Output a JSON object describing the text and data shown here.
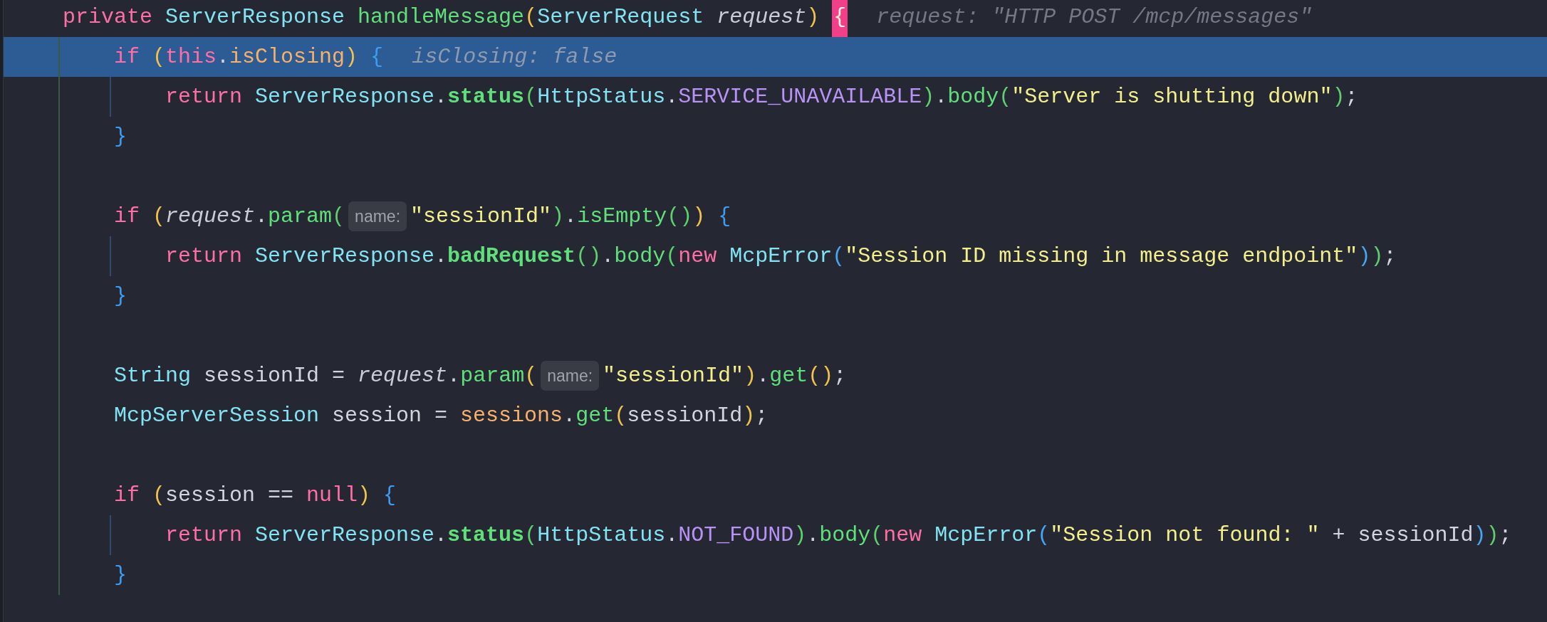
{
  "editor": {
    "lines": [
      {
        "kind": "code",
        "selected": false,
        "tokens": [
          {
            "kind": "keyword",
            "text": "private "
          },
          {
            "kind": "type",
            "text": "ServerResponse "
          },
          {
            "kind": "method",
            "text": "handleMessage"
          },
          {
            "kind": "paren1",
            "text": "("
          },
          {
            "kind": "type",
            "text": "ServerRequest "
          },
          {
            "kind": "param",
            "text": "request"
          },
          {
            "kind": "paren1",
            "text": ") "
          },
          {
            "kind": "brace_match",
            "text": "{"
          },
          {
            "kind": "hint",
            "text": "request: \"HTTP POST /mcp/messages\""
          }
        ],
        "children": [
          {
            "kind": "code",
            "selected": true,
            "tokens": [
              {
                "kind": "keyword",
                "text": "if "
              },
              {
                "kind": "paren1",
                "text": "("
              },
              {
                "kind": "keyword",
                "text": "this"
              },
              {
                "kind": "plain",
                "text": "."
              },
              {
                "kind": "field",
                "text": "isClosing"
              },
              {
                "kind": "paren1",
                "text": ") "
              },
              {
                "kind": "brace",
                "text": "{"
              },
              {
                "kind": "hint",
                "text": "isClosing: false"
              }
            ],
            "children": [
              {
                "kind": "code",
                "selected": false,
                "tokens": [
                  {
                    "kind": "keyword",
                    "text": "return "
                  },
                  {
                    "kind": "type",
                    "text": "ServerResponse"
                  },
                  {
                    "kind": "plain",
                    "text": "."
                  },
                  {
                    "kind": "method_bold",
                    "text": "status"
                  },
                  {
                    "kind": "paren2",
                    "text": "("
                  },
                  {
                    "kind": "type",
                    "text": "HttpStatus"
                  },
                  {
                    "kind": "plain",
                    "text": "."
                  },
                  {
                    "kind": "constant",
                    "text": "SERVICE_UNAVAILABLE"
                  },
                  {
                    "kind": "paren2",
                    "text": ")"
                  },
                  {
                    "kind": "plain",
                    "text": "."
                  },
                  {
                    "kind": "method",
                    "text": "body"
                  },
                  {
                    "kind": "paren2",
                    "text": "("
                  },
                  {
                    "kind": "string",
                    "text": "\"Server is shutting down\""
                  },
                  {
                    "kind": "paren2",
                    "text": ")"
                  },
                  {
                    "kind": "plain",
                    "text": ";"
                  }
                ]
              }
            ]
          },
          {
            "kind": "code",
            "selected": false,
            "tokens": [
              {
                "kind": "brace",
                "text": "}"
              }
            ]
          },
          {
            "kind": "blank",
            "selected": false
          },
          {
            "kind": "code",
            "selected": false,
            "tokens": [
              {
                "kind": "keyword",
                "text": "if "
              },
              {
                "kind": "paren1",
                "text": "("
              },
              {
                "kind": "param",
                "text": "request"
              },
              {
                "kind": "plain",
                "text": "."
              },
              {
                "kind": "method",
                "text": "param"
              },
              {
                "kind": "paren2",
                "text": "("
              },
              {
                "kind": "param_hint",
                "text": "name:"
              },
              {
                "kind": "string",
                "text": "\"sessionId\""
              },
              {
                "kind": "paren2",
                "text": ")"
              },
              {
                "kind": "plain",
                "text": "."
              },
              {
                "kind": "method",
                "text": "isEmpty"
              },
              {
                "kind": "paren2",
                "text": "()"
              },
              {
                "kind": "paren1",
                "text": ") "
              },
              {
                "kind": "brace",
                "text": "{"
              }
            ],
            "children": [
              {
                "kind": "code",
                "selected": false,
                "tokens": [
                  {
                    "kind": "keyword",
                    "text": "return "
                  },
                  {
                    "kind": "type",
                    "text": "ServerResponse"
                  },
                  {
                    "kind": "plain",
                    "text": "."
                  },
                  {
                    "kind": "method_bold",
                    "text": "badRequest"
                  },
                  {
                    "kind": "paren2",
                    "text": "()"
                  },
                  {
                    "kind": "plain",
                    "text": "."
                  },
                  {
                    "kind": "method",
                    "text": "body"
                  },
                  {
                    "kind": "paren2",
                    "text": "("
                  },
                  {
                    "kind": "keyword",
                    "text": "new "
                  },
                  {
                    "kind": "type",
                    "text": "McpError"
                  },
                  {
                    "kind": "paren3",
                    "text": "("
                  },
                  {
                    "kind": "string",
                    "text": "\"Session ID missing in message endpoint\""
                  },
                  {
                    "kind": "paren3",
                    "text": ")"
                  },
                  {
                    "kind": "paren2",
                    "text": ")"
                  },
                  {
                    "kind": "plain",
                    "text": ";"
                  }
                ]
              }
            ]
          },
          {
            "kind": "code",
            "selected": false,
            "tokens": [
              {
                "kind": "brace",
                "text": "}"
              }
            ]
          },
          {
            "kind": "blank",
            "selected": false
          },
          {
            "kind": "code",
            "selected": false,
            "tokens": [
              {
                "kind": "type",
                "text": "String "
              },
              {
                "kind": "plain",
                "text": "sessionId = "
              },
              {
                "kind": "param",
                "text": "request"
              },
              {
                "kind": "plain",
                "text": "."
              },
              {
                "kind": "method",
                "text": "param"
              },
              {
                "kind": "paren1",
                "text": "("
              },
              {
                "kind": "param_hint",
                "text": "name:"
              },
              {
                "kind": "string",
                "text": "\"sessionId\""
              },
              {
                "kind": "paren1",
                "text": ")"
              },
              {
                "kind": "plain",
                "text": "."
              },
              {
                "kind": "method",
                "text": "get"
              },
              {
                "kind": "paren1",
                "text": "()"
              },
              {
                "kind": "plain",
                "text": ";"
              }
            ]
          },
          {
            "kind": "code",
            "selected": false,
            "tokens": [
              {
                "kind": "type",
                "text": "McpServerSession "
              },
              {
                "kind": "plain",
                "text": "session = "
              },
              {
                "kind": "field",
                "text": "sessions"
              },
              {
                "kind": "plain",
                "text": "."
              },
              {
                "kind": "method",
                "text": "get"
              },
              {
                "kind": "paren1",
                "text": "("
              },
              {
                "kind": "plain",
                "text": "sessionId"
              },
              {
                "kind": "paren1",
                "text": ")"
              },
              {
                "kind": "plain",
                "text": ";"
              }
            ]
          },
          {
            "kind": "blank",
            "selected": false
          },
          {
            "kind": "code",
            "selected": false,
            "tokens": [
              {
                "kind": "keyword",
                "text": "if "
              },
              {
                "kind": "paren1",
                "text": "("
              },
              {
                "kind": "plain",
                "text": "session == "
              },
              {
                "kind": "keyword",
                "text": "null"
              },
              {
                "kind": "paren1",
                "text": ") "
              },
              {
                "kind": "brace",
                "text": "{"
              }
            ],
            "children": [
              {
                "kind": "code",
                "selected": false,
                "tokens": [
                  {
                    "kind": "keyword",
                    "text": "return "
                  },
                  {
                    "kind": "type",
                    "text": "ServerResponse"
                  },
                  {
                    "kind": "plain",
                    "text": "."
                  },
                  {
                    "kind": "method_bold",
                    "text": "status"
                  },
                  {
                    "kind": "paren2",
                    "text": "("
                  },
                  {
                    "kind": "type",
                    "text": "HttpStatus"
                  },
                  {
                    "kind": "plain",
                    "text": "."
                  },
                  {
                    "kind": "constant",
                    "text": "NOT_FOUND"
                  },
                  {
                    "kind": "paren2",
                    "text": ")"
                  },
                  {
                    "kind": "plain",
                    "text": "."
                  },
                  {
                    "kind": "method",
                    "text": "body"
                  },
                  {
                    "kind": "paren2",
                    "text": "("
                  },
                  {
                    "kind": "keyword",
                    "text": "new "
                  },
                  {
                    "kind": "type",
                    "text": "McpError"
                  },
                  {
                    "kind": "paren3",
                    "text": "("
                  },
                  {
                    "kind": "string",
                    "text": "\"Session not found: \""
                  },
                  {
                    "kind": "plain",
                    "text": " + sessionId"
                  },
                  {
                    "kind": "paren3",
                    "text": ")"
                  },
                  {
                    "kind": "paren2",
                    "text": ")"
                  },
                  {
                    "kind": "plain",
                    "text": ";"
                  }
                ]
              }
            ]
          },
          {
            "kind": "code",
            "selected": false,
            "tokens": [
              {
                "kind": "brace",
                "text": "}"
              }
            ]
          }
        ]
      }
    ]
  }
}
